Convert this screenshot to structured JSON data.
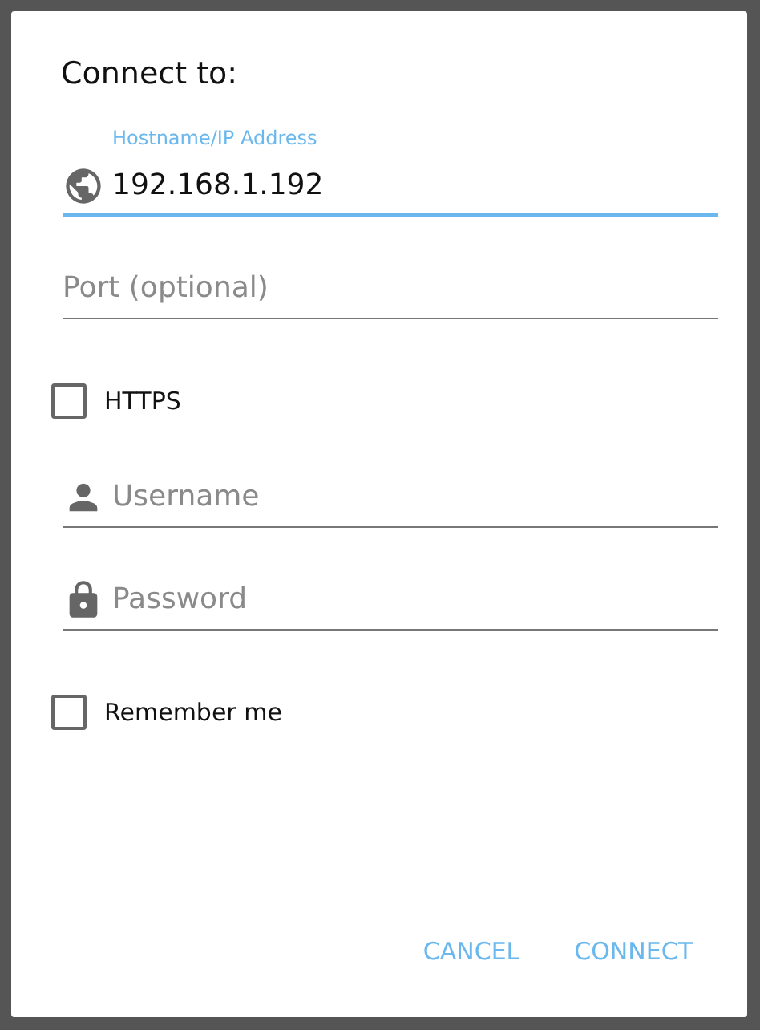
{
  "dialog": {
    "title": "Connect to:",
    "items": [
      {
        "kind": "host",
        "label": "Hostname/IP Address",
        "value": "192.168.1.192",
        "focused": true
      },
      {
        "kind": "port",
        "placeholder": "Port (optional)",
        "focused": false
      },
      {
        "kind": "checkbox",
        "label": "HTTPS",
        "checked": false
      },
      {
        "kind": "user",
        "placeholder": "Username",
        "focused": false
      },
      {
        "kind": "password",
        "placeholder": "Password",
        "focused": false
      },
      {
        "kind": "checkbox",
        "label": "Remember me",
        "checked": false
      }
    ],
    "buttons": [
      "CANCEL",
      "CONNECT"
    ]
  }
}
